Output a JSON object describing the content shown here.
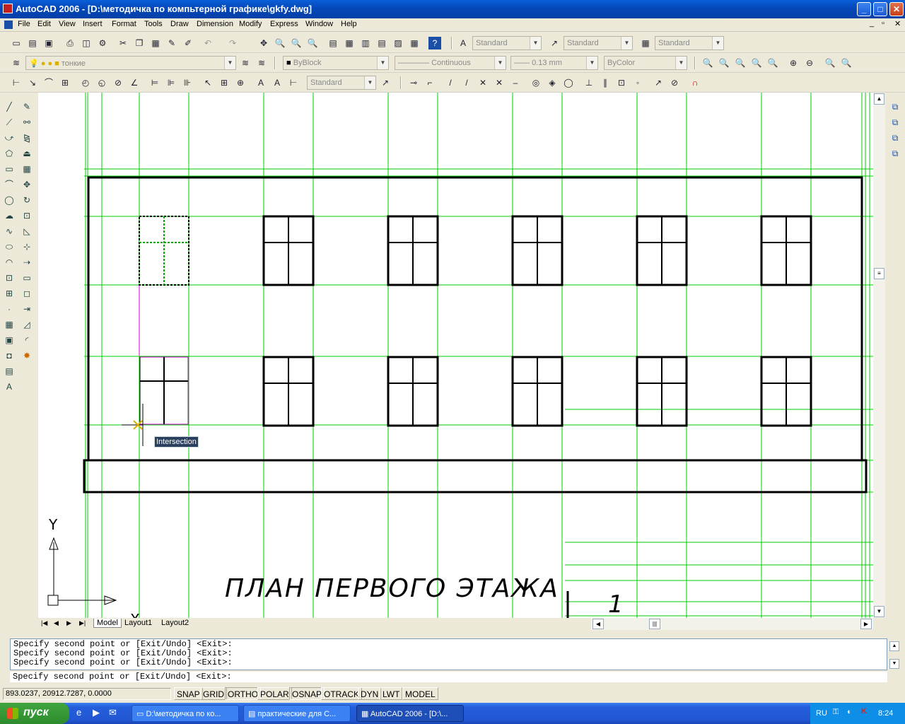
{
  "window": {
    "title": "AutoCAD 2006 - [D:\\методичка по компьтерной графике\\gkfy.dwg]",
    "min": "_",
    "max": "□",
    "close": "✕"
  },
  "menu": [
    "File",
    "Edit",
    "View",
    "Insert",
    "Format",
    "Tools",
    "Draw",
    "Dimension",
    "Modify",
    "Express",
    "Window",
    "Help"
  ],
  "styles": {
    "text_style": "Standard",
    "dim_style": "Standard",
    "table_style": "Standard"
  },
  "layers": {
    "current_layer": "тонкие",
    "color": "ByBlock",
    "linetype": "Continuous",
    "lineweight": "0.13 mm",
    "plot_style": "ByColor"
  },
  "dim_toolbar": {
    "dim_style": "Standard"
  },
  "drawing": {
    "title_text": "ПЛАН ПЕРВОГО ЭТАЖА",
    "scale_mark": "1",
    "snap_tooltip": "Intersection",
    "ucs_x": "X",
    "ucs_y": "Y",
    "colors": {
      "grid": "#00cc00",
      "line": "#000000",
      "highlight": "#cc00cc"
    }
  },
  "tabs": [
    "Model",
    "Layout1",
    "Layout2"
  ],
  "command": {
    "history": [
      "Specify second point or [Exit/Undo] <Exit>:",
      "Specify second point or [Exit/Undo] <Exit>:",
      "Specify second point or [Exit/Undo] <Exit>:"
    ],
    "current": "Specify second point or [Exit/Undo] <Exit>:"
  },
  "status": {
    "coords": "893.0237,  20912.7287, 0.0000",
    "buttons": [
      "SNAP",
      "GRID",
      "ORTHO",
      "POLAR",
      "OSNAP",
      "OTRACK",
      "DYN",
      "LWT",
      "MODEL"
    ]
  },
  "taskbar": {
    "start": "пуск",
    "tasks": [
      "D:\\методичка по ко...",
      "практические для С...",
      "AutoCAD 2006 - [D:\\..."
    ],
    "lang": "RU",
    "time": "8:24"
  }
}
